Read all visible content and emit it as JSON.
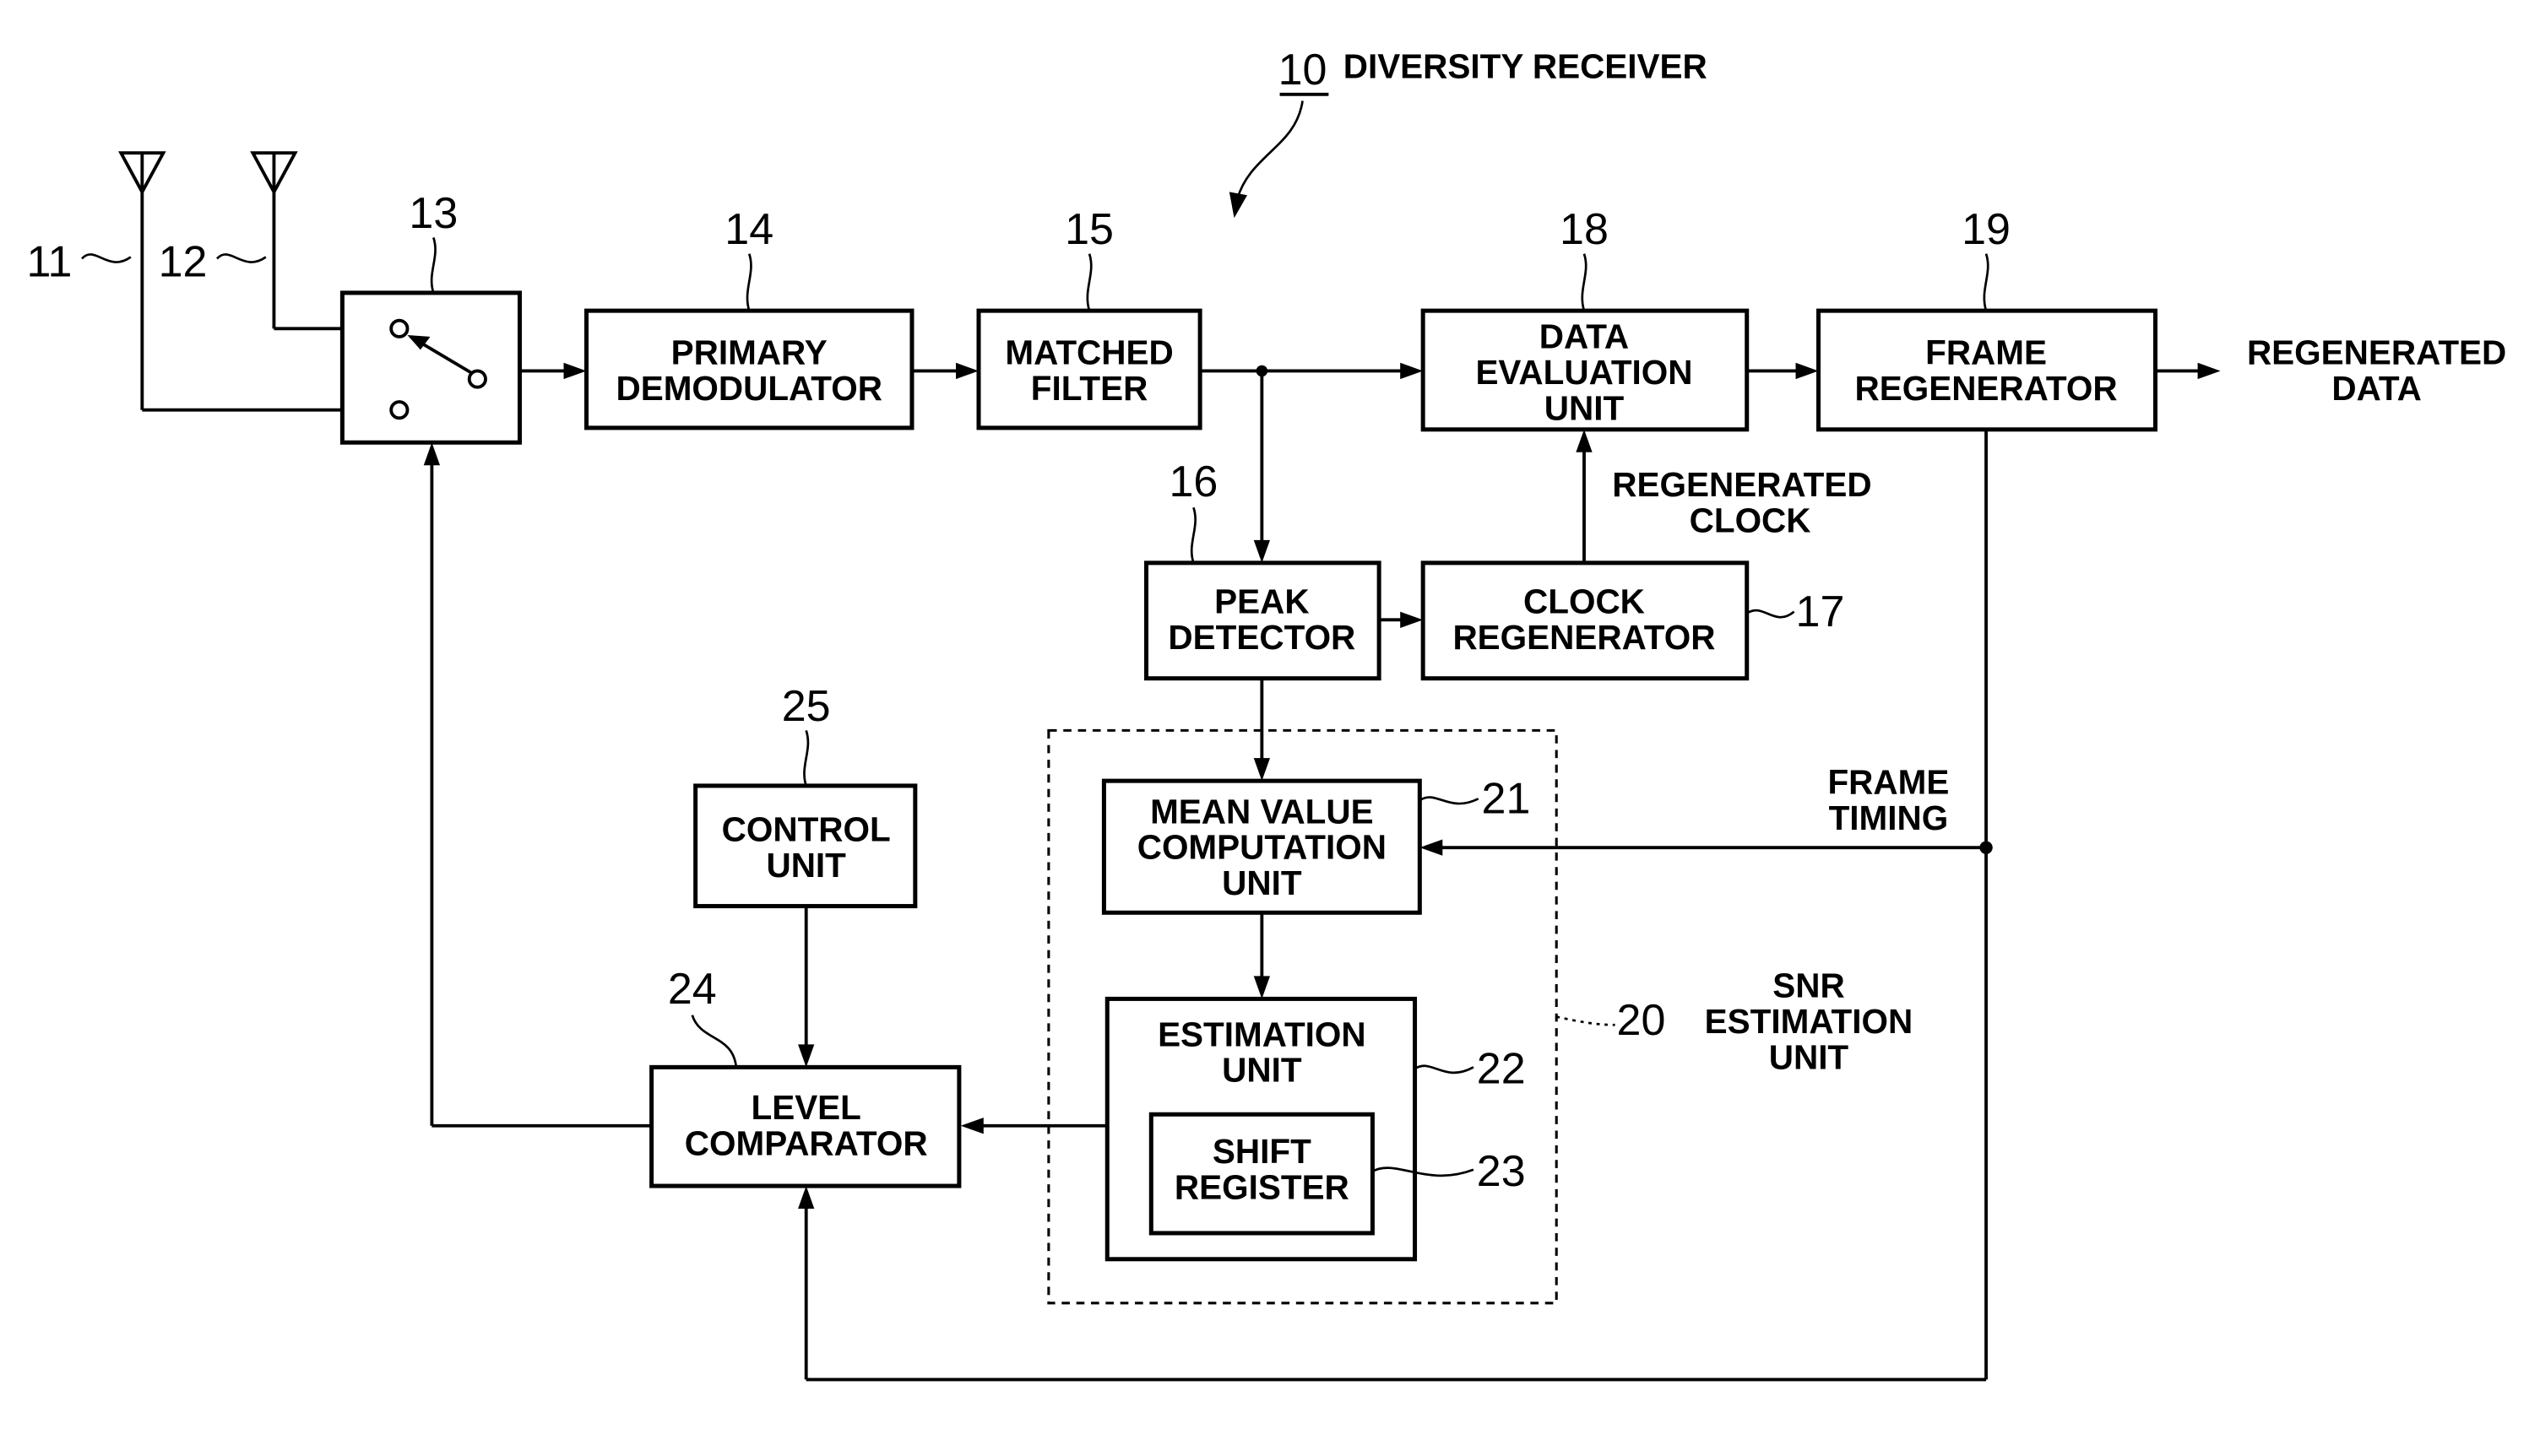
{
  "figure": {
    "title_ref": "10",
    "title": "DIVERSITY RECEIVER"
  },
  "antennas": [
    {
      "ref": "11"
    },
    {
      "ref": "12"
    }
  ],
  "switch": {
    "ref": "13"
  },
  "blocks": {
    "primary_demodulator": {
      "ref": "14",
      "lines": [
        "PRIMARY",
        "DEMODULATOR"
      ]
    },
    "matched_filter": {
      "ref": "15",
      "lines": [
        "MATCHED",
        "FILTER"
      ]
    },
    "peak_detector": {
      "ref": "16",
      "lines": [
        "PEAK",
        "DETECTOR"
      ]
    },
    "clock_regenerator": {
      "ref": "17",
      "lines": [
        "CLOCK",
        "REGENERATOR"
      ]
    },
    "data_evaluation_unit": {
      "ref": "18",
      "lines": [
        "DATA",
        "EVALUATION",
        "UNIT"
      ]
    },
    "frame_regenerator": {
      "ref": "19",
      "lines": [
        "FRAME",
        "REGENERATOR"
      ]
    },
    "snr_estimation_unit": {
      "ref": "20",
      "lines": [
        "SNR",
        "ESTIMATION",
        "UNIT"
      ]
    },
    "mean_value_computation_unit": {
      "ref": "21",
      "lines": [
        "MEAN VALUE",
        "COMPUTATION",
        "UNIT"
      ]
    },
    "estimation_unit": {
      "ref": "22",
      "lines": [
        "ESTIMATION",
        "UNIT"
      ]
    },
    "shift_register": {
      "ref": "23",
      "lines": [
        "SHIFT",
        "REGISTER"
      ]
    },
    "level_comparator": {
      "ref": "24",
      "lines": [
        "LEVEL",
        "COMPARATOR"
      ]
    },
    "control_unit": {
      "ref": "25",
      "lines": [
        "CONTROL",
        "UNIT"
      ]
    }
  },
  "signals": {
    "regenerated_data": [
      "REGENERATED",
      "DATA"
    ],
    "regenerated_clock": [
      "REGENERATED",
      "CLOCK"
    ],
    "frame_timing": [
      "FRAME",
      "TIMING"
    ]
  }
}
